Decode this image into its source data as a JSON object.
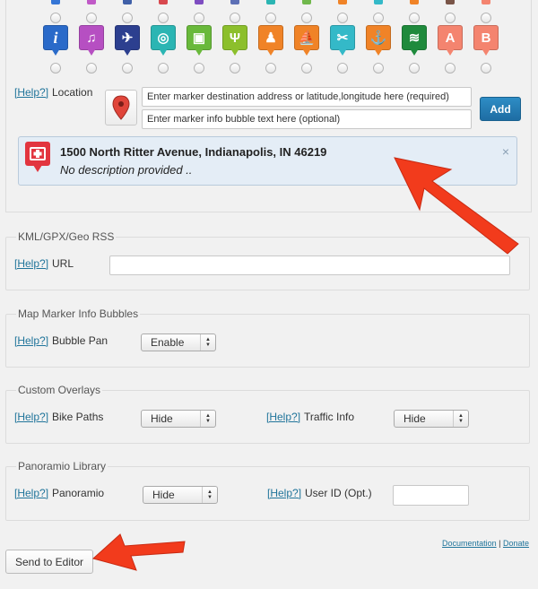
{
  "location": {
    "help": "[Help?]",
    "label": "Location",
    "address_placeholder": "Enter marker destination address or latitude,longitude here (required)",
    "info_placeholder": "Enter marker info bubble text here (optional)",
    "add_label": "Add"
  },
  "marker_icons": [
    {
      "name": "info-icon",
      "color": "#2a6ac9",
      "glyph": "i"
    },
    {
      "name": "saxophone-icon",
      "color": "#b64fc2",
      "glyph": "♫"
    },
    {
      "name": "airplane-icon",
      "color": "#2c3f8f",
      "glyph": "✈"
    },
    {
      "name": "ring-icon",
      "color": "#2bb5b3",
      "glyph": "◎"
    },
    {
      "name": "frame-icon",
      "color": "#69b93b",
      "glyph": "▣"
    },
    {
      "name": "menorah-icon",
      "color": "#8cbf2c",
      "glyph": "Ψ"
    },
    {
      "name": "hiking-icon",
      "color": "#f08327",
      "glyph": "♟"
    },
    {
      "name": "rowing-icon",
      "color": "#f08327",
      "glyph": "⛵"
    },
    {
      "name": "kayak-icon",
      "color": "#34b9c8",
      "glyph": "✂"
    },
    {
      "name": "canoe-icon",
      "color": "#f08327",
      "glyph": "⚓"
    },
    {
      "name": "water-icon",
      "color": "#1f8a3c",
      "glyph": "≋"
    },
    {
      "name": "letter-a-icon",
      "color": "#f4846f",
      "glyph": "A"
    },
    {
      "name": "letter-b-icon",
      "color": "#f4846f",
      "glyph": "B"
    }
  ],
  "peek_colors": [
    "#3576d6",
    "#c059c7",
    "#4060a8",
    "#d8484e",
    "#7e4dc1",
    "#5c6fb5",
    "#2bb5b3",
    "#70b84c",
    "#f08327",
    "#34b9c8",
    "#f08327",
    "#795548",
    "#f4846f"
  ],
  "marker_item": {
    "title": "1500 North Ritter Avenue, Indianapolis, IN 46219",
    "description": "No description provided ..",
    "close": "×"
  },
  "kml": {
    "legend": "KML/GPX/Geo RSS",
    "help": "[Help?]",
    "label": "URL",
    "value": ""
  },
  "bubbles": {
    "legend": "Map Marker Info Bubbles",
    "help": "[Help?]",
    "label": "Bubble Pan",
    "value": "Enable"
  },
  "overlays": {
    "legend": "Custom Overlays",
    "bike_help": "[Help?]",
    "bike_label": "Bike Paths",
    "bike_value": "Hide",
    "traffic_help": "[Help?]",
    "traffic_label": "Traffic Info",
    "traffic_value": "Hide"
  },
  "panoramio": {
    "legend": "Panoramio Library",
    "pano_help": "[Help?]",
    "pano_label": "Panoramio",
    "pano_value": "Hide",
    "user_help": "[Help?]",
    "user_label": "User ID (Opt.)",
    "user_value": ""
  },
  "footer": {
    "documentation": "Documentation",
    "separator": "|",
    "donate": "Donate",
    "send_label": "Send to Editor"
  },
  "accent": {
    "arrow": "#f23b1c",
    "marker_item_bg": "#e4edf6"
  }
}
